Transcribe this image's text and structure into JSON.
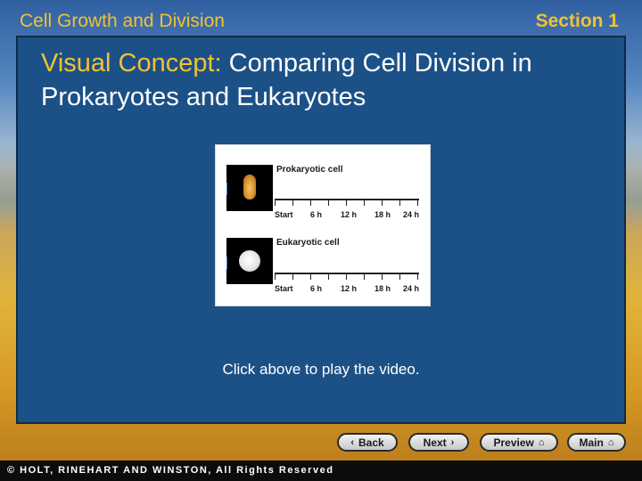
{
  "header": {
    "chapter": "Cell Growth and Division",
    "section": "Section 1"
  },
  "slide": {
    "title_prefix": "Visual Concept:",
    "title_rest": " Comparing Cell Division in Prokaryotes and Eukaryotes",
    "caption": "Click above to play the video."
  },
  "video": {
    "prokaryote_label": "Prokaryotic cell",
    "eukaryote_label": "Eukaryotic cell",
    "timeline_labels": [
      "Start",
      "6 h",
      "12 h",
      "18 h",
      "24 h"
    ]
  },
  "nav": {
    "back": "Back",
    "next": "Next",
    "preview": "Preview",
    "main": "Main",
    "back_icon": "‹",
    "next_icon": "›",
    "home_icon": "⌂"
  },
  "footer": {
    "copyright": "© HOLT, RINEHART AND WINSTON, All Rights Reserved"
  },
  "colors": {
    "accent_yellow": "#f2c230",
    "panel_blue": "#1c5187"
  }
}
